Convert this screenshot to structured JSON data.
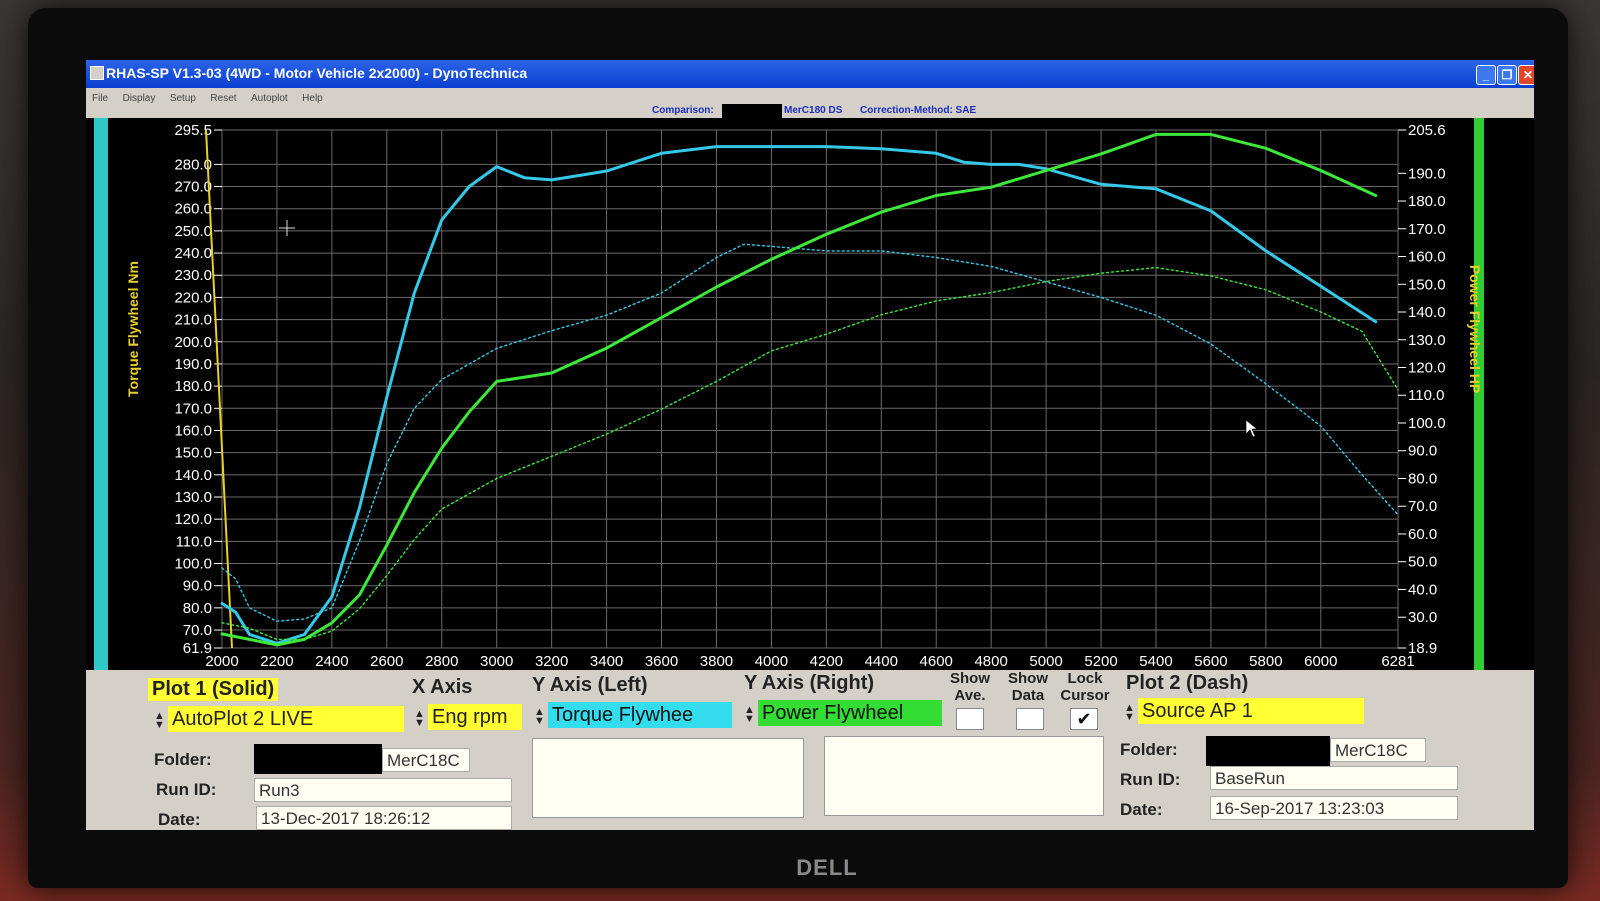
{
  "window": {
    "title": "RHAS-SP V1.3-03  (4WD - Motor Vehicle 2x2000) - DynoTechnica",
    "buttons": {
      "minimize": "_",
      "restore": "❐",
      "close": "✕"
    }
  },
  "menu": [
    "File",
    "Display",
    "Setup",
    "Reset",
    "Autoplot",
    "Help"
  ],
  "infobar": {
    "comparison_label": "Comparison:",
    "comparison_value": "MerC180 DS",
    "correction": "Correction-Method: SAE"
  },
  "chart_data": {
    "type": "line",
    "xlabel": "",
    "ylabel_left": "Torque Flywheel Nm",
    "ylabel_right": "Power Flywheel HP",
    "xlim": [
      2000,
      6281
    ],
    "ylim_left": [
      61.9,
      295.5
    ],
    "ylim_right": [
      18.9,
      205.6
    ],
    "x_ticks": [
      2000,
      2200,
      2400,
      2600,
      2800,
      3000,
      3200,
      3400,
      3600,
      3800,
      4000,
      4200,
      4400,
      4600,
      4800,
      5000,
      5200,
      5400,
      5600,
      5800,
      6000,
      6281
    ],
    "y_left_ticks": [
      "295.5",
      "280.0",
      "270.0",
      "260.0",
      "250.0",
      "240.0",
      "230.0",
      "220.0",
      "210.0",
      "200.0",
      "190.0",
      "180.0",
      "170.0",
      "160.0",
      "150.0",
      "140.0",
      "130.0",
      "120.0",
      "110.0",
      "100.0",
      "90.0",
      "80.0",
      "70.0",
      "61.9"
    ],
    "y_right_ticks": [
      "205.6",
      "190.0",
      "180.0",
      "170.0",
      "160.0",
      "150.0",
      "140.0",
      "130.0",
      "120.0",
      "110.0",
      "100.0",
      "90.0",
      "80.0",
      "70.0",
      "60.0",
      "50.0",
      "40.0",
      "30.0",
      "18.9"
    ],
    "grid": true,
    "colors": {
      "torque": "#35c8e8",
      "power": "#3ee83a",
      "cursor": "#e8d02a",
      "axis_text": "#ffffff",
      "left_label": "#e8d02a",
      "right_label": "#e8d02a",
      "left_bar": "#2fc8c8",
      "right_bar": "#33cc33"
    },
    "series": [
      {
        "axis": "left",
        "style": "solid",
        "color": "torque",
        "x": [
          2000,
          2050,
          2100,
          2200,
          2300,
          2400,
          2500,
          2600,
          2700,
          2800,
          2900,
          3000,
          3100,
          3200,
          3300,
          3400,
          3600,
          3800,
          4000,
          4200,
          4400,
          4600,
          4700,
          4800,
          4900,
          5000,
          5200,
          5400,
          5600,
          5800,
          6000,
          6200
        ],
        "y": [
          82,
          78,
          68,
          64,
          68,
          85,
          125,
          175,
          222,
          255,
          270,
          279,
          274,
          273,
          275,
          277,
          285,
          288,
          288,
          288,
          287,
          285,
          281,
          280,
          280,
          278,
          271,
          269,
          259,
          241,
          225,
          209
        ]
      },
      {
        "axis": "left",
        "style": "dash",
        "color": "torque",
        "x": [
          2000,
          2050,
          2100,
          2200,
          2300,
          2400,
          2500,
          2600,
          2700,
          2800,
          3000,
          3200,
          3400,
          3600,
          3800,
          3900,
          4000,
          4200,
          4400,
          4600,
          4800,
          5000,
          5200,
          5400,
          5600,
          5800,
          6000,
          6150,
          6281
        ],
        "y": [
          98,
          93,
          80,
          74,
          75,
          80,
          110,
          145,
          170,
          183,
          197,
          205,
          212,
          222,
          238,
          244,
          243,
          241,
          241,
          238,
          234,
          227,
          220,
          212,
          199,
          181,
          162,
          140,
          122
        ]
      },
      {
        "axis": "right",
        "style": "solid",
        "color": "power",
        "x": [
          2000,
          2100,
          2200,
          2300,
          2400,
          2500,
          2600,
          2700,
          2800,
          2900,
          3000,
          3200,
          3400,
          3600,
          3800,
          4000,
          4200,
          4400,
          4600,
          4800,
          5000,
          5200,
          5400,
          5600,
          5800,
          6000,
          6200
        ],
        "y": [
          24,
          22,
          20,
          22,
          28,
          38,
          56,
          75,
          91,
          104,
          115,
          118,
          127,
          138,
          149,
          159,
          168,
          176,
          182,
          185,
          191,
          197,
          204,
          204,
          199,
          191,
          182
        ]
      },
      {
        "axis": "right",
        "style": "dash",
        "color": "power",
        "x": [
          2000,
          2100,
          2200,
          2300,
          2400,
          2500,
          2600,
          2700,
          2800,
          3000,
          3200,
          3400,
          3600,
          3800,
          4000,
          4200,
          4400,
          4600,
          4800,
          5000,
          5200,
          5400,
          5600,
          5800,
          6000,
          6150,
          6281
        ],
        "y": [
          28,
          26,
          22,
          22,
          25,
          33,
          45,
          58,
          69,
          80,
          88,
          96,
          105,
          115,
          126,
          132,
          139,
          144,
          147,
          151,
          154,
          156,
          153,
          148,
          140,
          133,
          112
        ]
      }
    ]
  },
  "panel": {
    "plot1_title": "Plot 1 (Solid)",
    "x_axis_title": "X Axis",
    "y_left_title": "Y Axis (Left)",
    "y_right_title": "Y Axis (Right)",
    "plot2_title": "Plot 2 (Dash)",
    "plot1_source": "AutoPlot 2 LIVE",
    "x_axis_value": "Eng rpm",
    "y_left_value": "Torque Flywhee",
    "y_right_value": "Power Flywheel",
    "plot2_source": "Source AP 1",
    "show_ave_label": "Show\nAve.",
    "show_data_label": "Show\nData",
    "lock_cursor_label": "Lock\nCursor",
    "show_ave_checked": "",
    "show_data_checked": "",
    "lock_cursor_checked": "✔",
    "folder_label": "Folder:",
    "run_id_label": "Run ID:",
    "date_label": "Date:",
    "plot1_folder": "MerC18C",
    "plot1_run_id": "Run3",
    "plot1_date": "13-Dec-2017  18:26:12",
    "plot2_folder": "MerC18C",
    "plot2_run_id": "BaseRun",
    "plot2_date": "16-Sep-2017  13:23:03"
  },
  "monitor_brand": "DELL"
}
